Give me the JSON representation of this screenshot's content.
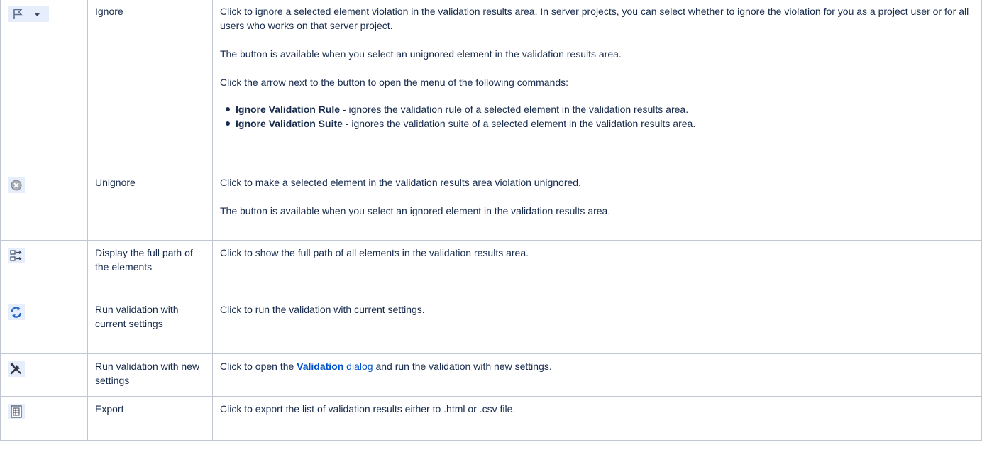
{
  "rows": [
    {
      "icon": "flag-dropdown-icon",
      "name": "Ignore",
      "paragraphs": [
        "Click to ignore a selected element violation in the validation results area. In server projects, you can select whether to ignore the violation for you as a project user or for all users who works on that server project.",
        "The button is available when you select an unignored element in the validation results area.",
        "Click the arrow next to the button to open the menu of the following commands:"
      ],
      "bullets": [
        {
          "term": "Ignore Validation Rule",
          "text": " - ignores the validation rule of a selected element in the validation results area."
        },
        {
          "term": "Ignore Validation Suite",
          "text": " - ignores the validation suite of a selected element in the validation results area."
        }
      ]
    },
    {
      "icon": "unignore-circle-x-icon",
      "name": "Unignore",
      "paragraphs": [
        "Click to make a selected element in the validation results area violation unignored.",
        "The button is available when you select an ignored element in the validation results area."
      ]
    },
    {
      "icon": "full-path-icon",
      "name": "Display the full path of the elements",
      "paragraphs": [
        "Click to show the full path of all elements in the validation results area."
      ]
    },
    {
      "icon": "refresh-arrows-icon",
      "name": "Run validation with current settings",
      "paragraphs": [
        "Click to run the validation with current settings."
      ]
    },
    {
      "icon": "tools-icon",
      "name": "Run validation with new settings",
      "desc_prefix": "Click to open the ",
      "link_bold": "Validation",
      "link_rest": " dialog",
      "desc_suffix": " and run the validation with new settings."
    },
    {
      "icon": "export-document-icon",
      "name": "Export",
      "paragraphs": [
        "Click to export the list of validation results either to .html or .csv file."
      ]
    }
  ],
  "colors": {
    "link": "#0052cc",
    "text": "#172b4d",
    "border": "#c1c7d0",
    "icon_bg": "#e6eefb"
  }
}
